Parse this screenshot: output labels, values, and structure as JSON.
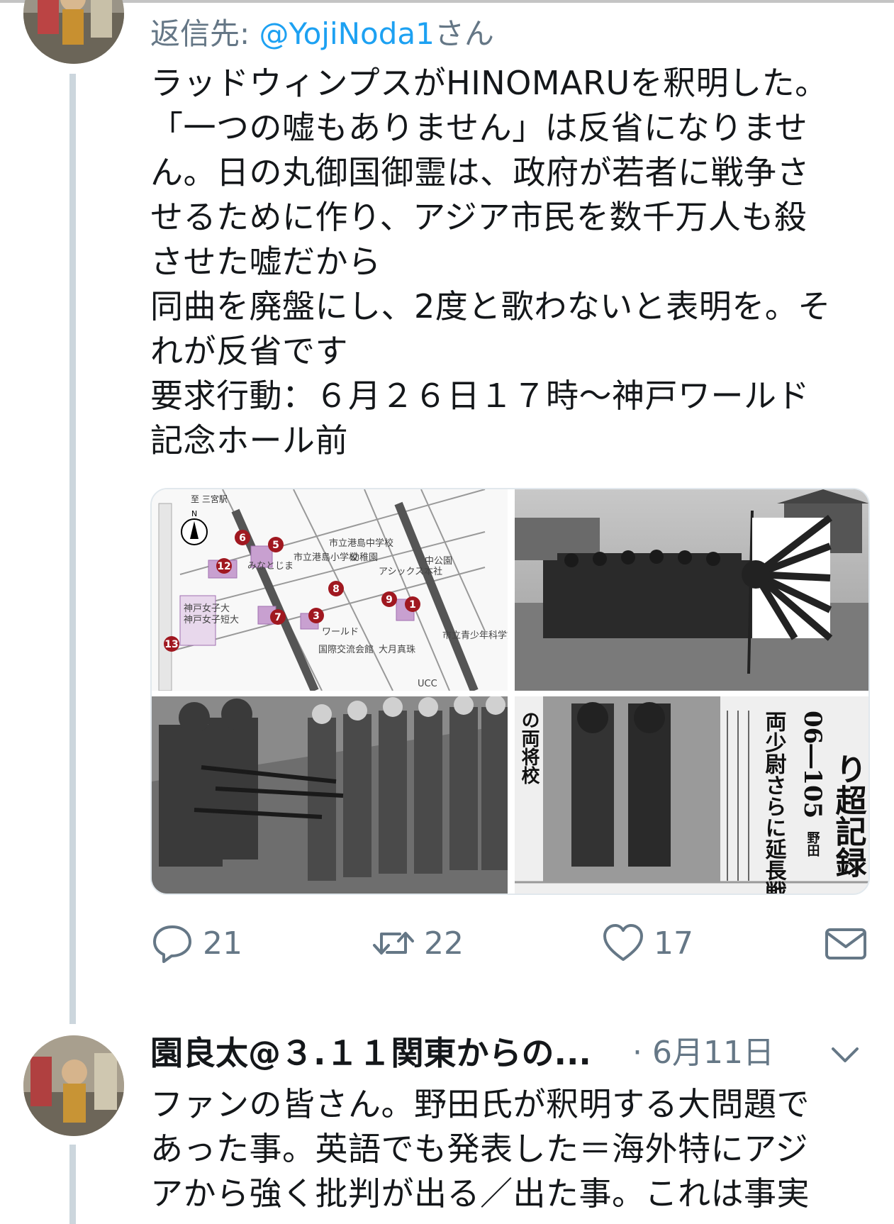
{
  "tweet": {
    "reply_prefix": "返信先: ",
    "reply_handle": "@YojiNoda1",
    "reply_suffix": "さん",
    "text_lines": [
      "ラッドウィンプスがHINOMARUを釈明した。",
      "「一つの嘘もありません」は反省になりませ",
      "ん。日の丸御国御霊は、政府が若者に戦争さ",
      "せるために作り、アジア市民を数千万人も殺",
      "させた嘘だから",
      "同曲を廃盤にし、2度と歌わないと表明を。そ",
      "れが反省です",
      "要求行動：６月２６日１７時〜神戸ワールド",
      "記念ホール前"
    ],
    "actions": {
      "reply_icon": "reply-icon",
      "reply_count": "21",
      "retweet_icon": "retweet-icon",
      "retweet_count": "22",
      "like_icon": "heart-icon",
      "like_count": "17",
      "dm_icon": "envelope-icon"
    }
  },
  "media": {
    "map_labels": {
      "station": "至 三宮駅",
      "north": "N",
      "school1": "市立港島中学校",
      "kinder": "幼稚園",
      "school2": "市立港島小学校",
      "asics": "アシックス本社",
      "station2": "みなとじま",
      "nakakoen": "中公園",
      "women": "神戸女子大",
      "women2": "神戸女子短大",
      "world": "ワールド",
      "kaigi": "国際交流会館",
      "ootsuki": "大月真珠",
      "science": "市立青少年科学館",
      "ucc": "UCC",
      "markers": [
        "6",
        "5",
        "12",
        "8",
        "9",
        "1",
        "7",
        "3",
        "13"
      ]
    },
    "news_headline_1": "り超記録",
    "news_headline_2": "06―105",
    "news_headline_3": "両少尉さらに延長戦",
    "news_headline_4": "の両将校",
    "news_headline_5": "野田"
  },
  "tweet2": {
    "name": "園良太@３.１１関東からの...",
    "date": "· 6月11日",
    "caret_icon": "chevron-down-icon",
    "text_lines": [
      "ファンの皆さん。野田氏が釈明する大問題で",
      "あった事。英語でも発表した＝海外特にアジ",
      "アから強く批判が出る／出た事。これは事実"
    ]
  },
  "colors": {
    "accent": "#1da1f2",
    "muted": "#657786",
    "thread_line": "#ccd6dd",
    "text": "#14171a"
  }
}
